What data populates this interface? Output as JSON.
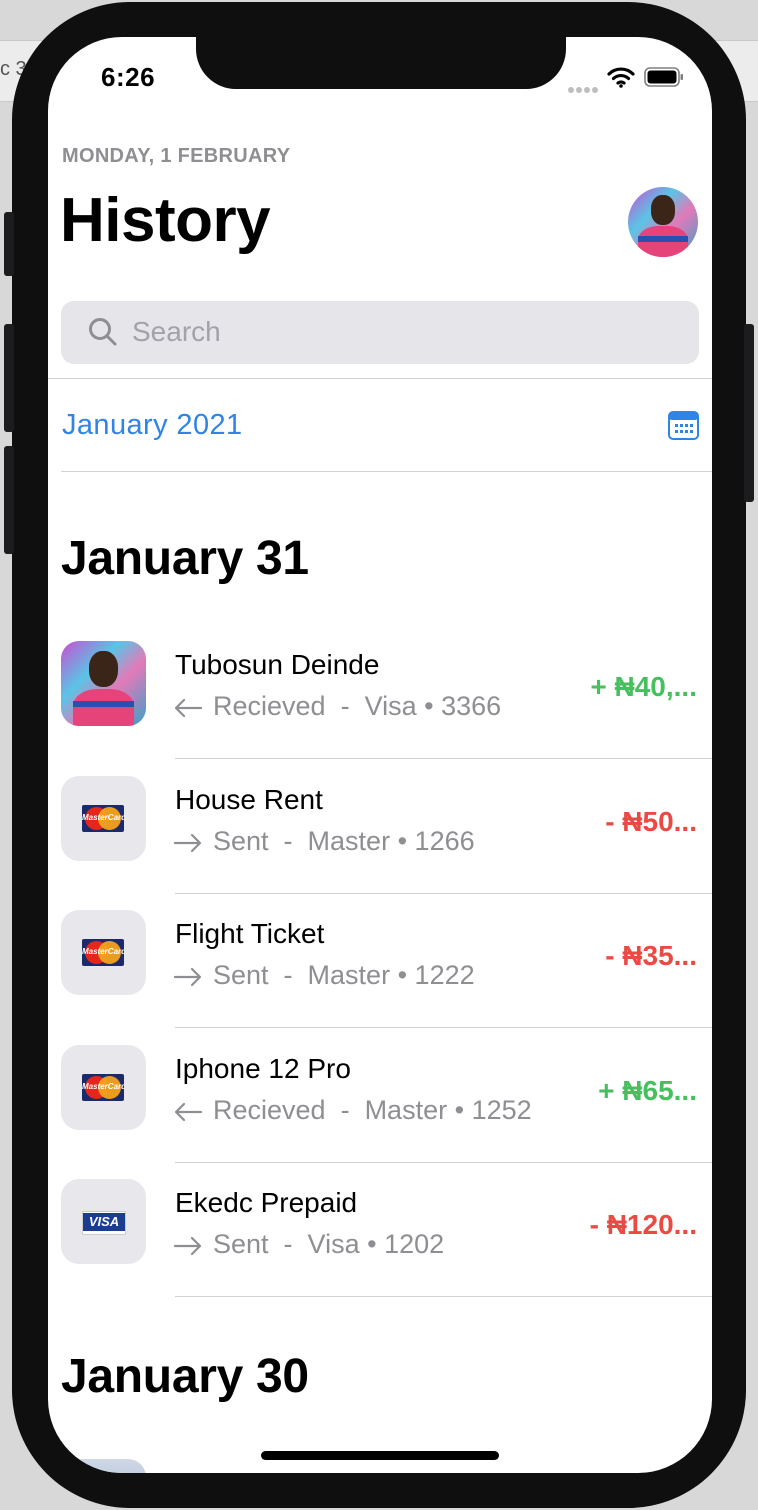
{
  "desktop_fragment": "c 3",
  "status_bar": {
    "time": "6:26"
  },
  "header": {
    "date_caption": "MONDAY, 1 FEBRUARY",
    "title": "History"
  },
  "search": {
    "placeholder": "Search"
  },
  "month_selector": {
    "label": "January  2021"
  },
  "sections": [
    {
      "heading": "January 31",
      "transactions": [
        {
          "name": "Tubosun Deinde",
          "direction": "Recieved",
          "card": "Visa",
          "last4": "3366",
          "amount": "+  ₦40,...",
          "type": "in",
          "thumb": "person"
        },
        {
          "name": "House Rent",
          "direction": "Sent",
          "card": "Master",
          "last4": "1266",
          "amount": "-  ₦50...",
          "type": "out",
          "thumb": "mastercard"
        },
        {
          "name": "Flight Ticket",
          "direction": "Sent",
          "card": "Master",
          "last4": "1222",
          "amount": "-  ₦35...",
          "type": "out",
          "thumb": "mastercard"
        },
        {
          "name": "Iphone 12 Pro",
          "direction": "Recieved",
          "card": "Master",
          "last4": "1252",
          "amount": "+  ₦65...",
          "type": "in",
          "thumb": "mastercard"
        },
        {
          "name": "Ekedc Prepaid",
          "direction": "Sent",
          "card": "Visa",
          "last4": "1202",
          "amount": "-  ₦120...",
          "type": "out",
          "thumb": "visa"
        }
      ]
    },
    {
      "heading": "January 30"
    }
  ],
  "card_logo_text": {
    "mastercard": "MasterCard",
    "visa": "VISA"
  },
  "colors": {
    "accent": "#2f84e6",
    "income": "#47bf5e",
    "expense": "#e94b44",
    "secondary_text": "#8e8e93"
  }
}
